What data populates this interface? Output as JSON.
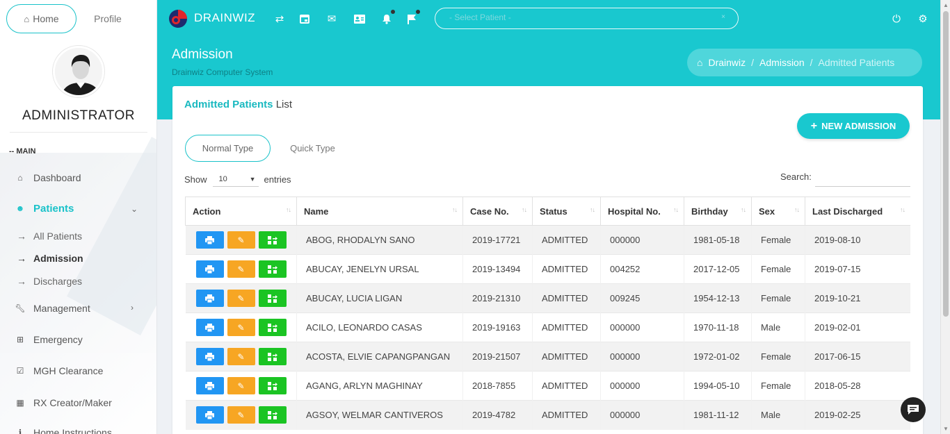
{
  "sidebar": {
    "home_label": "Home",
    "profile_label": "Profile",
    "role": "ADMINISTRATOR",
    "section_label": "-- MAIN",
    "items": [
      {
        "label": "Dashboard",
        "icon": "home-icon"
      },
      {
        "label": "Patients",
        "icon": "smile-icon"
      },
      {
        "label": "Management",
        "icon": "wrench-icon"
      },
      {
        "label": "Emergency",
        "icon": "plus-square-icon"
      },
      {
        "label": "MGH Clearance",
        "icon": "check-square-icon"
      },
      {
        "label": "RX Creator/Maker",
        "icon": "grid-icon"
      },
      {
        "label": "Home Instructions",
        "icon": "info-icon"
      }
    ],
    "patient_sub": [
      "All Patients",
      "Admission",
      "Discharges"
    ]
  },
  "topbar": {
    "brand": "DRAINWIZ",
    "patient_placeholder": "- Select Patient -"
  },
  "header": {
    "title": "Admission",
    "subtitle": "Drainwiz Computer System",
    "breadcrumb": [
      "Drainwiz",
      "Admission",
      "Admitted Patients"
    ]
  },
  "card": {
    "title_bold": "Admitted Patients",
    "title_rest": "List",
    "new_button": "NEW ADMISSION",
    "type_normal": "Normal Type",
    "type_quick": "Quick Type",
    "show_label": "Show",
    "entries_value": "10",
    "entries_label": "entries",
    "search_label": "Search:"
  },
  "table": {
    "columns": [
      "Action",
      "Name",
      "Case No.",
      "Status",
      "Hospital No.",
      "Birthday",
      "Sex",
      "Last Discharged"
    ],
    "rows": [
      [
        "ABOG, RHODALYN SANO",
        "2019-17721",
        "ADMITTED",
        "000000",
        "1981-05-18",
        "Female",
        "2019-08-10"
      ],
      [
        "ABUCAY, JENELYN URSAL",
        "2019-13494",
        "ADMITTED",
        "004252",
        "2017-12-05",
        "Female",
        "2019-07-15"
      ],
      [
        "ABUCAY, LUCIA LIGAN",
        "2019-21310",
        "ADMITTED",
        "009245",
        "1954-12-13",
        "Female",
        "2019-10-21"
      ],
      [
        "ACILO, LEONARDO CASAS",
        "2019-19163",
        "ADMITTED",
        "000000",
        "1970-11-18",
        "Male",
        "2019-02-01"
      ],
      [
        "ACOSTA, ELVIE CAPANGPANGAN",
        "2019-21507",
        "ADMITTED",
        "000000",
        "1972-01-02",
        "Female",
        "2017-06-15"
      ],
      [
        "AGANG, ARLYN MAGHINAY",
        "2018-7855",
        "ADMITTED",
        "000000",
        "1994-05-10",
        "Female",
        "2018-05-28"
      ],
      [
        "AGSOY, WELMAR CANTIVEROS",
        "2019-4782",
        "ADMITTED",
        "000000",
        "1981-11-12",
        "Male",
        "2019-02-25"
      ]
    ]
  },
  "colors": {
    "accent": "#19c8cf",
    "print": "#2196f3",
    "edit": "#f7a623",
    "move": "#1bc423"
  }
}
